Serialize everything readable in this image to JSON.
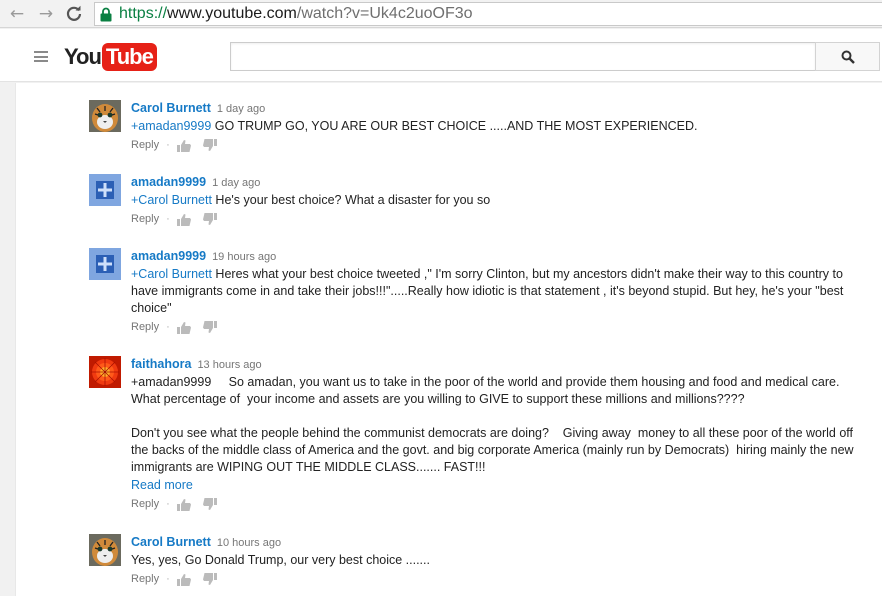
{
  "browser": {
    "url_scheme": "https://",
    "url_host": "www.youtube.com",
    "url_path": "/watch?v=Uk4c2uoOF3o"
  },
  "header": {
    "logo_you": "You",
    "logo_tube": "Tube",
    "search_placeholder": ""
  },
  "comments": [
    {
      "author": "Carol Burnett",
      "time": "1 day ago",
      "avatar": "tiger-avatar",
      "mention": "+amadan9999",
      "text": " GO TRUMP GO, YOU ARE OUR BEST CHOICE .....AND THE MOST EXPERIENCED.",
      "read_more": "",
      "reply": "Reply"
    },
    {
      "author": "amadan9999",
      "time": "1 day ago",
      "avatar": "default-avatar",
      "mention": "+Carol Burnett",
      "text": " He's your best choice? What a disaster for you so",
      "read_more": "",
      "reply": "Reply"
    },
    {
      "author": "amadan9999",
      "time": "19 hours ago",
      "avatar": "default-avatar",
      "mention": "+Carol Burnett",
      "text": " Heres what your best choice tweeted ,\" I'm sorry Clinton, but my ancestors didn't make their way to this country to have immigrants come in and take their jobs!!!\".....Really how idiotic is that statement , it's beyond stupid. But hey, he's your \"best choice\"",
      "read_more": "",
      "reply": "Reply"
    },
    {
      "author": "faithahora",
      "time": "13 hours ago",
      "avatar": "red-flower-avatar",
      "mention": "",
      "text": "+amadan9999     So amadan, you want us to take in the poor of the world and provide them housing and food and medical care.  What percentage of  your income and assets are you willing to GIVE to support these millions and millions????\n\nDon't you see what the people behind the communist democrats are doing?    Giving away  money to all these poor of the world off the backs of the middle class of America and the govt. and big corporate America (mainly run by Democrats)  hiring mainly the new immigrants are WIPING OUT THE MIDDLE CLASS....... FAST!!!",
      "read_more": "Read more",
      "reply": "Reply"
    },
    {
      "author": "Carol Burnett",
      "time": "10 hours ago",
      "avatar": "tiger-avatar",
      "mention": "",
      "text": "Yes, yes, Go Donald Trump, our very best choice .......",
      "read_more": "",
      "reply": "Reply"
    }
  ],
  "colors": {
    "link": "#167ac6",
    "youtube_red": "#e62117",
    "secure_green": "#0b8043"
  }
}
